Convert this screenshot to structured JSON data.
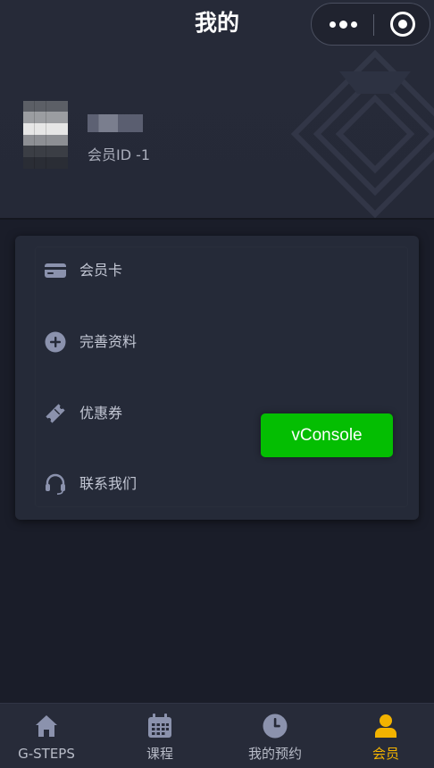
{
  "nav": {
    "title": "我的",
    "more_icon": "more-dots-icon",
    "close_icon": "capsule-close-icon"
  },
  "profile": {
    "member_id": "会员ID -1"
  },
  "menu": {
    "items": [
      {
        "label": "会员卡",
        "icon": "card-icon"
      },
      {
        "label": "完善资料",
        "icon": "plus-circle-icon"
      },
      {
        "label": "优惠券",
        "icon": "ticket-icon"
      },
      {
        "label": "联系我们",
        "icon": "headset-icon"
      }
    ]
  },
  "vconsole": {
    "label": "vConsole"
  },
  "tabbar": {
    "items": [
      {
        "label": "G-STEPS",
        "icon": "home-icon"
      },
      {
        "label": "课程",
        "icon": "calendar-icon"
      },
      {
        "label": "我的预约",
        "icon": "clock-icon"
      },
      {
        "label": "会员",
        "icon": "user-icon",
        "active": true
      }
    ]
  },
  "colors": {
    "background": "#1a1d29",
    "header": "#262a38",
    "card": "#252a38",
    "accent": "#f3b300",
    "vconsole_green": "#04be02",
    "icon": "#8b92ad"
  }
}
